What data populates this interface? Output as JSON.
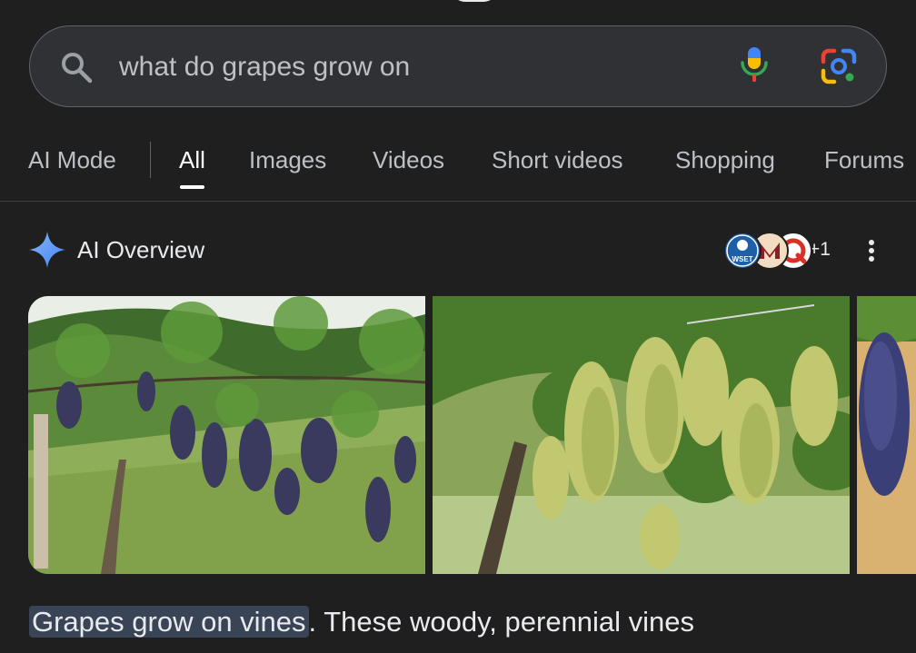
{
  "search": {
    "query": "what do grapes grow on",
    "icons": {
      "search": "search-icon",
      "voice": "mic-icon",
      "lens": "google-lens-icon"
    }
  },
  "tabs": [
    {
      "label": "AI Mode",
      "active": false
    },
    {
      "label": "All",
      "active": true
    },
    {
      "label": "Images",
      "active": false
    },
    {
      "label": "Videos",
      "active": false
    },
    {
      "label": "Short videos",
      "active": false
    },
    {
      "label": "Shopping",
      "active": false
    },
    {
      "label": "Forums",
      "active": false
    }
  ],
  "ai_overview": {
    "title": "AI Overview",
    "sources": {
      "logos": [
        {
          "text": "WSET",
          "icon": "wset-logo-icon"
        },
        {
          "text": "",
          "icon": "source-logo-icon"
        },
        {
          "text": "",
          "icon": "source-logo-icon"
        }
      ],
      "more": "+1"
    },
    "images": [
      {
        "icon": "dark-grapes-vineyard-image"
      },
      {
        "icon": "green-grapes-vine-image"
      },
      {
        "icon": "dark-grapes-cluster-image"
      }
    ],
    "answer": {
      "highlight": "Grapes grow on vines",
      "rest": ". These woody, perennial vines"
    }
  },
  "colors": {
    "background": "#1f1f1f",
    "search_bg": "#303134",
    "text": "#e8eaed",
    "highlight": "#394457",
    "google_blue": "#4285f4",
    "google_red": "#ea4335",
    "google_yellow": "#fbbc04",
    "google_green": "#34a853"
  }
}
